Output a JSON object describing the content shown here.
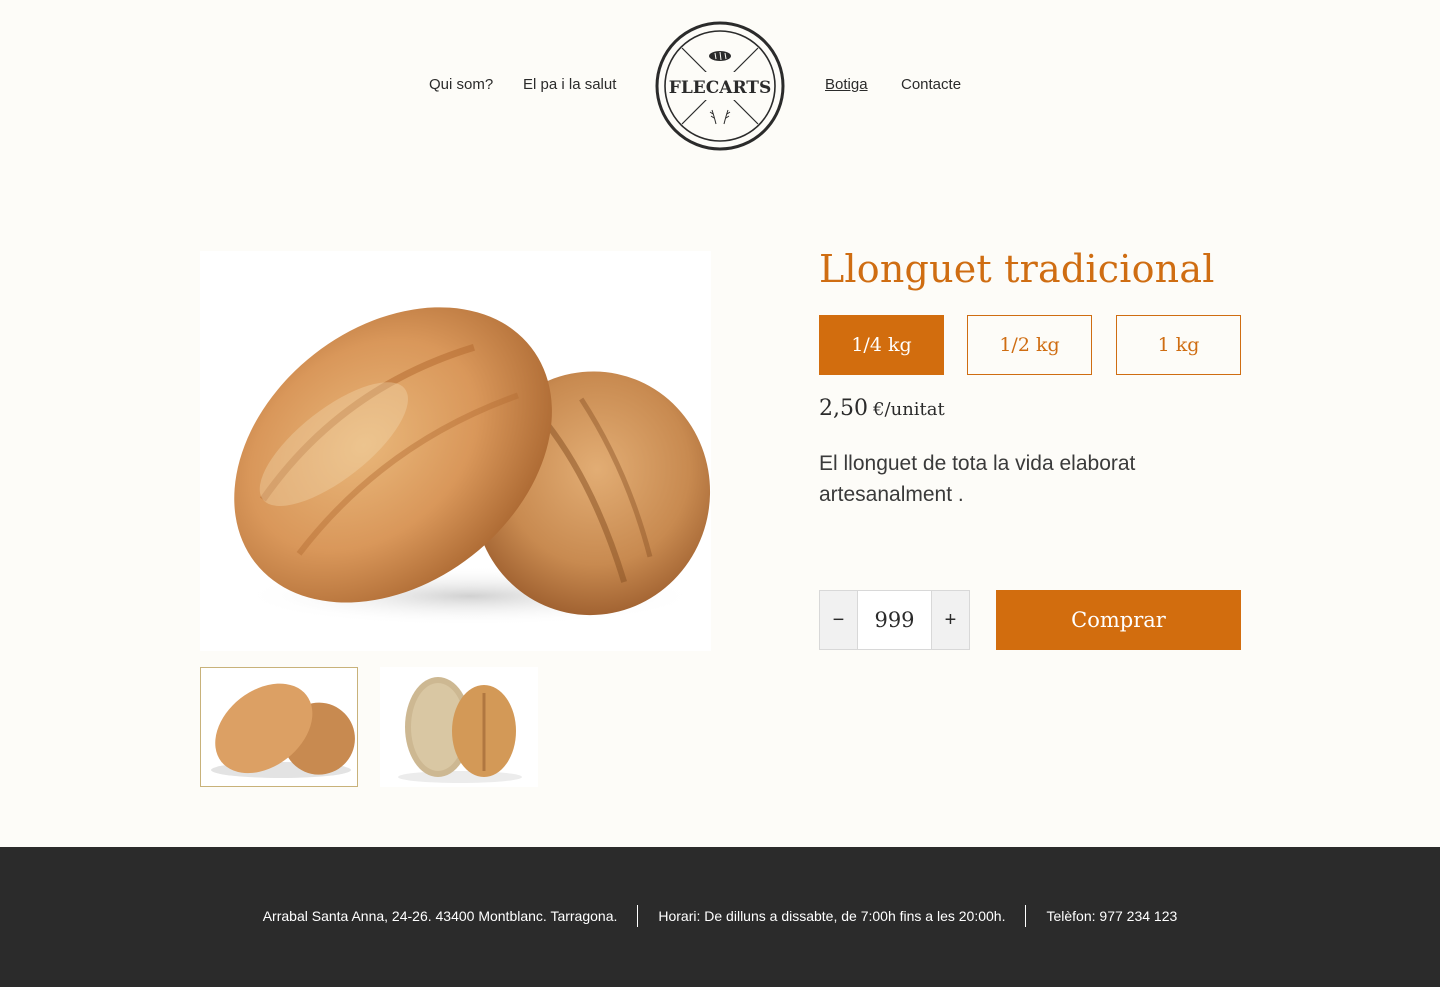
{
  "nav": {
    "left": [
      "Qui som?",
      "El pa i la salut"
    ],
    "right": [
      "Botiga",
      "Contacte"
    ],
    "active": "Botiga"
  },
  "logo": {
    "text": "FLECARTS",
    "icons": [
      "bread-icon",
      "wheat-icon"
    ]
  },
  "product": {
    "title": "Llonguet tradicional",
    "sizes": [
      "1/4 kg",
      "1/2 kg",
      "1 kg"
    ],
    "selected_size": "1/4 kg",
    "price_amount": "2,50",
    "price_unit": "€/unitat",
    "description": "El llonguet de tota la vida elaborat artesanalment .",
    "quantity": "999",
    "minus_label": "−",
    "plus_label": "+",
    "buy_label": "Comprar",
    "selected_thumbnail": 0
  },
  "footer": {
    "address": "Arrabal Santa Anna, 24-26. 43400 Montblanc. Tarragona.",
    "hours": "Horari: De dilluns a dissabte, de 7:00h fins a les 20:00h.",
    "phone": "Telèfon: 977 234 123"
  },
  "colors": {
    "accent": "#d26d0e",
    "background": "#fdfcf8",
    "footer": "#2b2b2b"
  }
}
